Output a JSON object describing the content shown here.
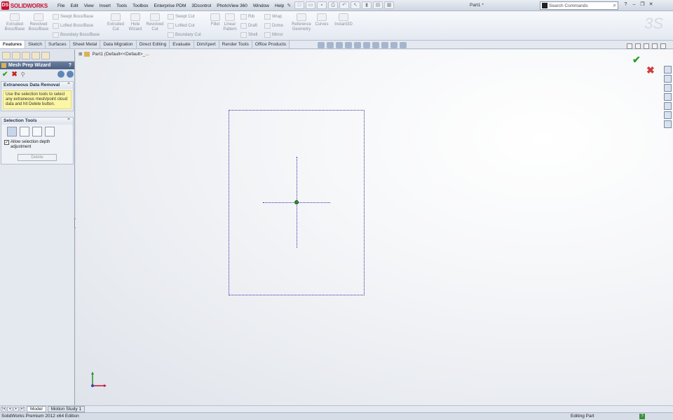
{
  "app": {
    "logo_text": "SOLIDWORKS",
    "document_title": "Part1 *",
    "search_placeholder": "Search Commands"
  },
  "menu": [
    "File",
    "Edit",
    "View",
    "Insert",
    "Tools",
    "Toolbox",
    "Enterprise PDM",
    "3Dcontrol",
    "PhotoView 360",
    "Window",
    "Help"
  ],
  "commands": {
    "extruded_boss": "Extruded\nBoss/Base",
    "revolved_boss": "Revolved\nBoss/Base",
    "swept_boss": "Swept Boss/Base",
    "lofted_boss": "Lofted Boss/Base",
    "boundary_boss": "Boundary Boss/Base",
    "extruded_cut": "Extruded\nCut",
    "hole_wizard": "Hole\nWizard",
    "revolved_cut": "Revolved\nCut",
    "swept_cut": "Swept Cut",
    "lofted_cut": "Lofted Cut",
    "boundary_cut": "Boundary Cut",
    "fillet": "Fillet",
    "linear_pattern": "Linear\nPattern",
    "rib": "Rib",
    "draft": "Draft",
    "shell": "Shell",
    "wrap": "Wrap",
    "dome": "Dome",
    "mirror": "Mirror",
    "reference_geometry": "Reference\nGeometry",
    "curves": "Curves",
    "instant3d": "Instant3D"
  },
  "tabs": [
    "Features",
    "Sketch",
    "Surfaces",
    "Sheet Metal",
    "Data Migration",
    "Direct Editing",
    "Evaluate",
    "DimXpert",
    "Render Tools",
    "Office Products"
  ],
  "property_manager": {
    "title": "Mesh Prep Wizard",
    "help": "?",
    "group1_title": "Extraneous Data Removal",
    "group1_message": "Use the selection tools to select any extraneous mesh/point cloud data and hit Delete button.",
    "group2_title": "Selection Tools",
    "checkbox_label": "Allow selection depth adjustment",
    "checkbox_checked": true,
    "delete_button": "Delete"
  },
  "tree_path": "Part1  (Default<<Default>_...",
  "bottom_tabs": [
    "Model",
    "Motion Study 1"
  ],
  "status": {
    "left": "SolidWorks Premium 2012 x64 Edition",
    "mode": "Editing Part",
    "help": "?"
  }
}
